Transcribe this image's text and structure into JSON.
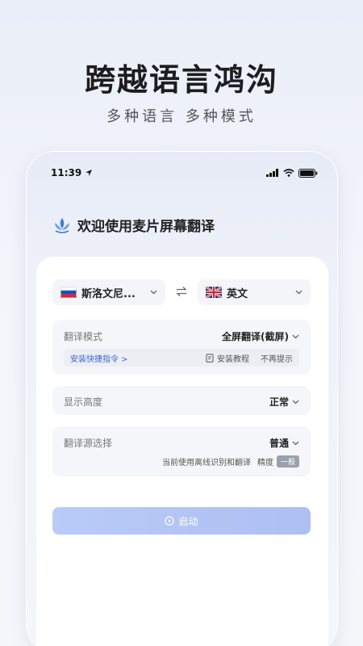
{
  "hero": {
    "title": "跨越语言鸿沟",
    "subtitle": "多种语言  多种模式"
  },
  "status_bar": {
    "time": "11:39"
  },
  "app": {
    "greeting": "欢迎使用麦片屏幕翻译",
    "accent_color": "#3b66d6"
  },
  "languages": {
    "source": "斯洛文尼...",
    "target": "英文"
  },
  "translate_mode": {
    "label": "翻译模式",
    "value": "全屏翻译(截屏)",
    "shortcut_link": "安装快捷指令 >",
    "tutorial": "安装教程",
    "dismiss": "不再提示"
  },
  "display_height": {
    "label": "显示高度",
    "value": "正常"
  },
  "source_select": {
    "label": "翻译源选择",
    "value": "普通",
    "note": "当前使用离线识别和翻译",
    "precision_label": "精度",
    "precision_value": "一般"
  },
  "start_button": {
    "label": "启动"
  }
}
